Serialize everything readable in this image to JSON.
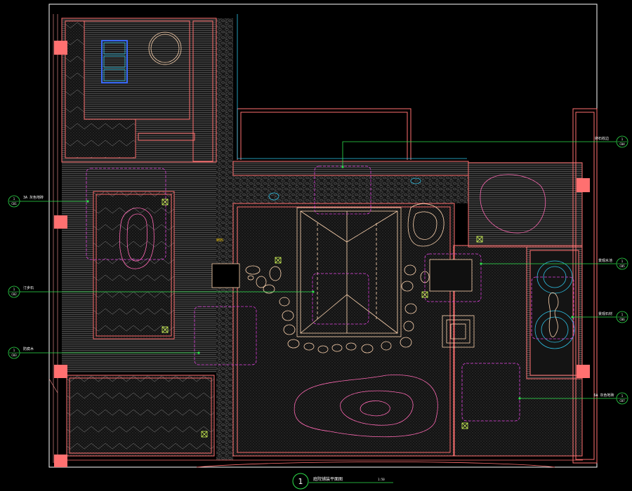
{
  "drawing": {
    "title": "庭院铺装平面图",
    "scale": "1:50",
    "view_number": "1",
    "colors": {
      "background": "#000000",
      "wall": "#ff6f6f",
      "paving": "#9a9a9a",
      "canopy": "#e040e0",
      "callout": "#2ee04b",
      "glass": "#2ec4e8",
      "rock": "#ffd5b0",
      "boundary": "#ffffff",
      "column": "#ff7070"
    }
  },
  "callouts_left": [
    {
      "num": "1",
      "sub": "C01",
      "text": "3A 灰色地砖"
    },
    {
      "num": "1",
      "sub": "C02",
      "text": "汀步石"
    },
    {
      "num": "1",
      "sub": "C03",
      "text": "防腐木"
    }
  ],
  "callouts_right": [
    {
      "num": "1",
      "sub": "C04",
      "text": "卵石收边"
    },
    {
      "num": "1",
      "sub": "C05",
      "text": "景观水池"
    },
    {
      "num": "1",
      "sub": "C06",
      "text": "景观石材"
    },
    {
      "num": "1",
      "sub": "C07",
      "text": "6A 灰色地砖"
    }
  ],
  "inline_label": "卵石"
}
